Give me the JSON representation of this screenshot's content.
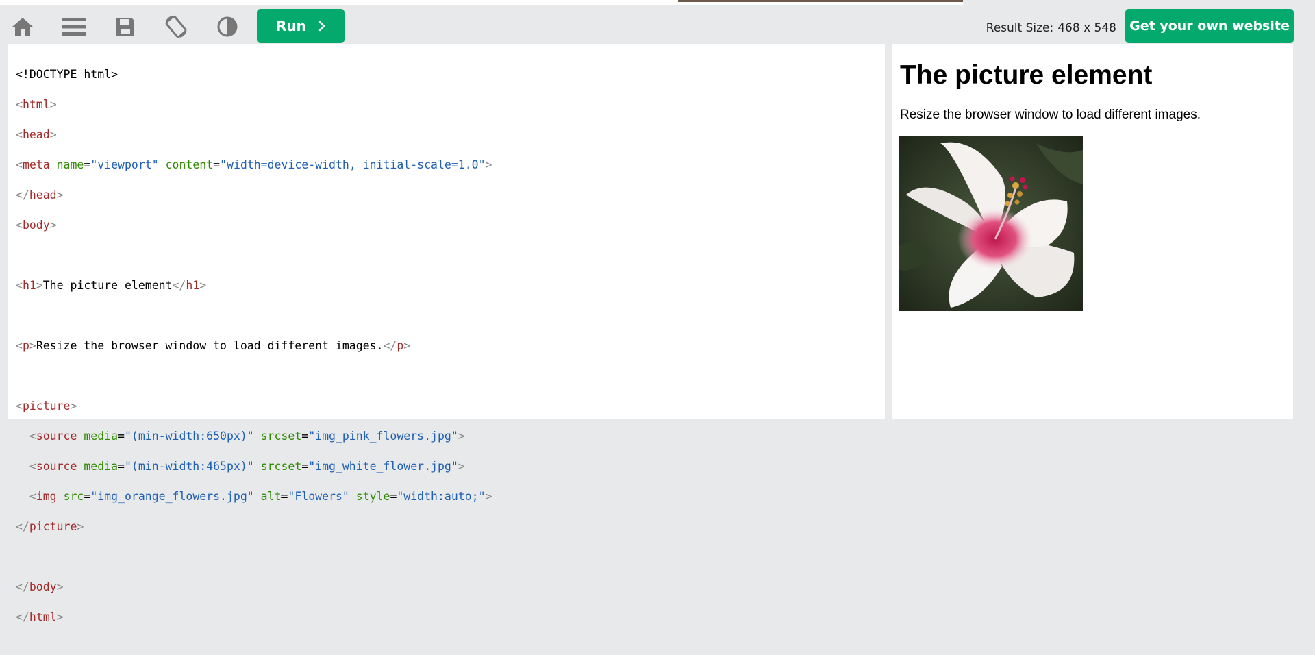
{
  "toolbar": {
    "icons": [
      "home-icon",
      "menu-icon",
      "save-icon",
      "rotate-icon",
      "theme-icon"
    ],
    "run_label": "Run",
    "result_size_label": "Result Size:",
    "result_size_value": "468 x 548",
    "get_website_label": "Get your own website"
  },
  "colors": {
    "accent": "#04aa6d",
    "toolbar_bg": "#e7e9eb",
    "icon_gray": "#777777",
    "tag": "#a52a2a",
    "attr_name": "#2e8b00",
    "attr_value": "#1f5fb3"
  },
  "code": {
    "doctype": "<!DOCTYPE html>",
    "tag_html": "html",
    "tag_head": "head",
    "tag_meta": "meta",
    "attr_name": "name",
    "attr_name_val": "\"viewport\"",
    "attr_content": "content",
    "attr_content_val": "\"width=device-width, initial-scale=1.0\"",
    "tag_body": "body",
    "tag_h1": "h1",
    "h1_text": "The picture element",
    "tag_p": "p",
    "p_text": "Resize the browser window to load different images.",
    "tag_picture": "picture",
    "tag_source": "source",
    "attr_media": "media",
    "media_1": "\"(min-width:650px)\"",
    "media_2": "\"(min-width:465px)\"",
    "attr_srcset": "srcset",
    "srcset_1": "\"img_pink_flowers.jpg\"",
    "srcset_2": "\"img_white_flower.jpg\"",
    "tag_img": "img",
    "attr_src": "src",
    "src_val": "\"img_orange_flowers.jpg\"",
    "attr_alt": "alt",
    "alt_val": "\"Flowers\"",
    "attr_style": "style",
    "style_val": "\"width:auto;\""
  },
  "result": {
    "heading": "The picture element",
    "paragraph": "Resize the browser window to load different images.",
    "image_alt": "Flowers"
  }
}
